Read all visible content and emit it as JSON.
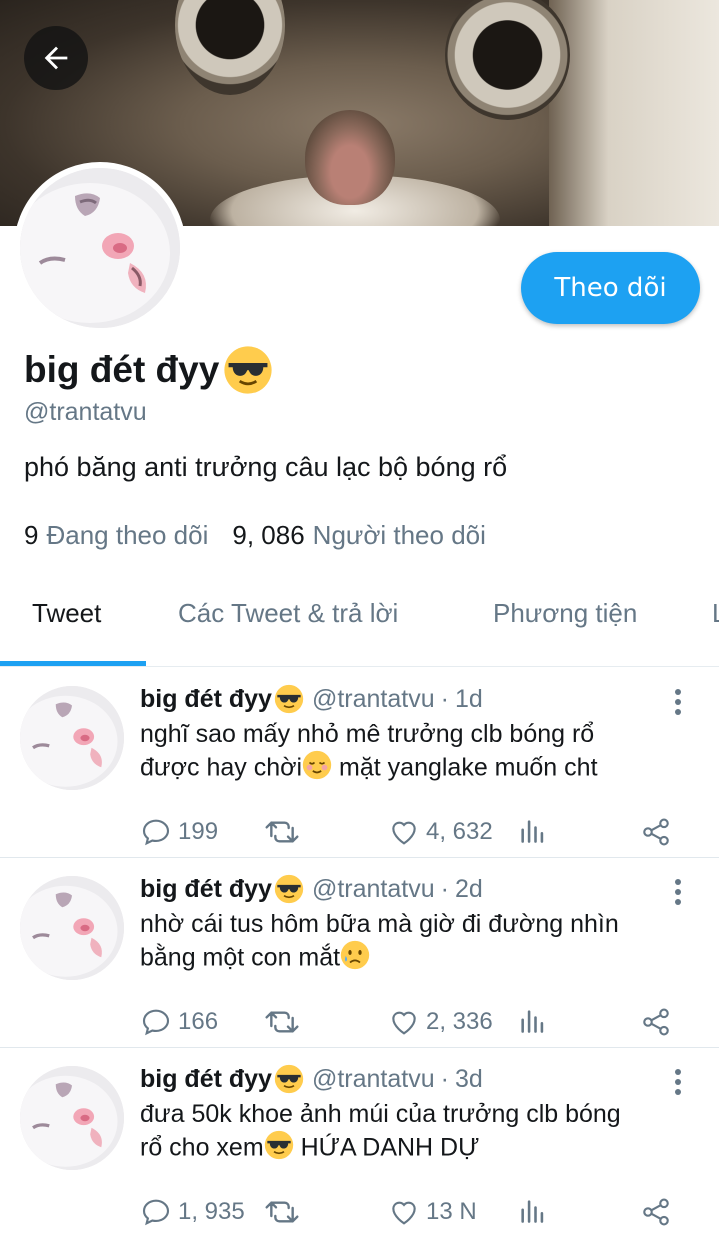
{
  "profile": {
    "name": "big đét đyy",
    "name_emoji": "sunglasses-emoji",
    "handle": "@trantatvu",
    "bio": "phó băng anti trưởng câu lạc bộ bóng rổ",
    "following_count": "9",
    "following_label": "Đang theo dõi",
    "followers_count": "9, 086",
    "followers_label": "Người theo dõi",
    "follow_button": "Theo dõi"
  },
  "tabs": [
    {
      "label": "Tweet",
      "active": true
    },
    {
      "label": "Các Tweet & trả lời",
      "active": false
    },
    {
      "label": "Phương tiện",
      "active": false
    },
    {
      "label": "L",
      "active": false
    }
  ],
  "tweets": [
    {
      "name": "big đét đyy",
      "handle": "@trantatvu",
      "time": "1d",
      "line1": "nghĩ sao mấy nhỏ mê trưởng clb bóng rổ",
      "line2_a": "được hay chời",
      "line2_emoji": "relieved-emoji",
      "line2_b": " mặt yanglake muốn cht",
      "replies": "199",
      "likes": "4, 632"
    },
    {
      "name": "big đét đyy",
      "handle": "@trantatvu",
      "time": "2d",
      "line1": "nhờ cái tus hôm bữa mà giờ đi đường nhìn",
      "line2_a": "bằng một con mắt",
      "line2_emoji": "sad-emoji",
      "line2_b": "",
      "replies": "166",
      "likes": "2, 336"
    },
    {
      "name": "big đét đyy",
      "handle": "@trantatvu",
      "time": "3d",
      "line1": "đưa 50k khoe ảnh múi của trưởng clb bóng",
      "line2_a": "rổ cho xem",
      "line2_emoji": "sunglasses-emoji",
      "line2_b": " HỨA DANH DỰ",
      "replies": "1, 935",
      "likes": "13 N"
    }
  ],
  "colors": {
    "accent": "#1da1f2",
    "secondary_text": "#657786",
    "primary_text": "#14171a"
  }
}
